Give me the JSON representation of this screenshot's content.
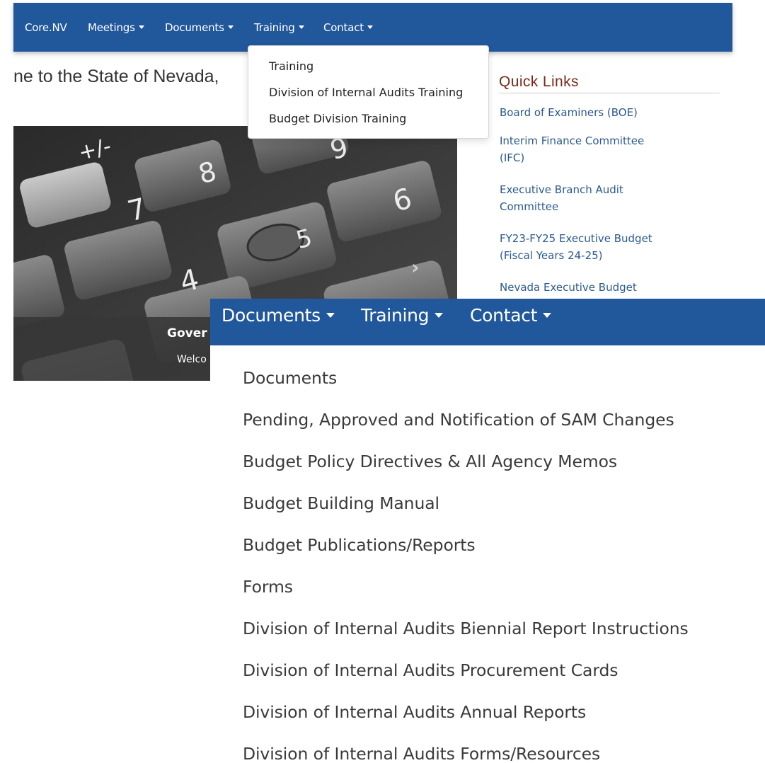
{
  "top_nav": {
    "items": [
      {
        "label": "Core.NV",
        "has_caret": false
      },
      {
        "label": "Meetings",
        "has_caret": true
      },
      {
        "label": "Documents",
        "has_caret": true
      },
      {
        "label": "Training",
        "has_caret": true
      },
      {
        "label": "Contact",
        "has_caret": true
      }
    ]
  },
  "welcome_text": "ne to the State of Nevada,",
  "training_menu": {
    "items": [
      "Training",
      "Division of Internal Audits Training",
      "Budget Division Training"
    ]
  },
  "quick_links": {
    "title": "Quick Links",
    "links": [
      {
        "line1": "Board of Examiners (BOE)",
        "line2": ""
      },
      {
        "line1": "Interim Finance Committee",
        "line2": "(IFC)"
      },
      {
        "line1": "Executive Branch Audit",
        "line2": "Committee"
      },
      {
        "line1": "FY23-FY25 Executive Budget",
        "line2": "(Fiscal Years 24-25)"
      },
      {
        "line1": "Nevada Executive Budget",
        "line2": ""
      }
    ]
  },
  "carousel": {
    "caption_title": "Gover",
    "caption_subtitle": "Welco",
    "keys": [
      "+/-",
      "8",
      "9",
      "7",
      "6",
      "5",
      "4"
    ]
  },
  "zoom_nav": {
    "items": [
      {
        "label": "Documents",
        "has_caret": true
      },
      {
        "label": "Training",
        "has_caret": true
      },
      {
        "label": "Contact",
        "has_caret": true
      }
    ]
  },
  "documents_menu": {
    "items": [
      "Documents",
      "Pending, Approved and Notification of SAM Changes",
      "Budget Policy Directives & All Agency Memos",
      "Budget Building Manual",
      "Budget Publications/Reports",
      "Forms",
      "Division of Internal Audits Biennial Report Instructions",
      "Division of Internal Audits Procurement Cards",
      "Division of Internal Audits Annual Reports",
      "Division of Internal Audits Forms/Resources"
    ]
  },
  "colors": {
    "navbar": "#21579b",
    "quick_links_title": "#7a2a18",
    "link": "#2a5a8e"
  }
}
